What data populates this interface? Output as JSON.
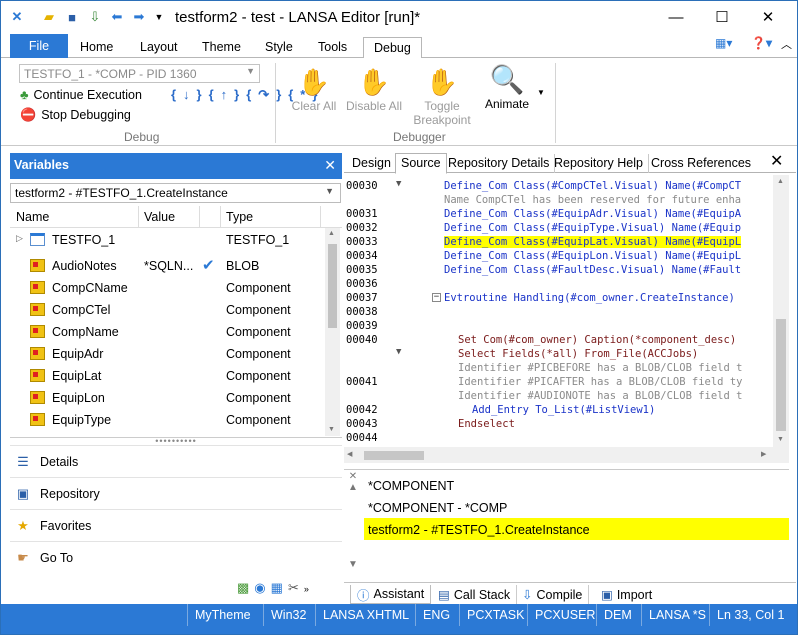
{
  "window": {
    "title": "testform2 - test - LANSA Editor [run]*"
  },
  "ribbon_tabs": [
    "File",
    "Home",
    "Layout",
    "Theme",
    "Style",
    "Tools",
    "Debug"
  ],
  "ribbon": {
    "process_select": "TESTFO_1 - *COMP - PID 1360",
    "continue_label": "Continue Execution",
    "stop_label": "Stop Debugging",
    "debug_group_label": "Debug",
    "clear_all_label": "Clear All",
    "disable_all_label": "Disable All",
    "toggle_label_1": "Toggle",
    "toggle_label_2": "Breakpoint",
    "animate_label": "Animate",
    "debugger_group_label": "Debugger"
  },
  "variables": {
    "header": "Variables",
    "selector": "testform2 - #TESTFO_1.CreateInstance",
    "columns": [
      "Name",
      "Value",
      "Type"
    ],
    "rows": [
      {
        "name": "TESTFO_1",
        "value": "",
        "type": "TESTFO_1",
        "icon": "form-icon",
        "checked": false
      },
      {
        "name": "AudioNotes",
        "value": "*SQLN...",
        "type": "BLOB",
        "icon": "blob-icon",
        "checked": true
      },
      {
        "name": "CompCName",
        "value": "",
        "type": "Component",
        "icon": "blob-icon",
        "checked": false
      },
      {
        "name": "CompCTel",
        "value": "",
        "type": "Component",
        "icon": "blob-icon",
        "checked": false
      },
      {
        "name": "CompName",
        "value": "",
        "type": "Component",
        "icon": "blob-icon",
        "checked": false
      },
      {
        "name": "EquipAdr",
        "value": "",
        "type": "Component",
        "icon": "blob-icon",
        "checked": false
      },
      {
        "name": "EquipLat",
        "value": "",
        "type": "Component",
        "icon": "blob-icon",
        "checked": false
      },
      {
        "name": "EquipLon",
        "value": "",
        "type": "Component",
        "icon": "blob-icon",
        "checked": false
      },
      {
        "name": "EquipType",
        "value": "",
        "type": "Component",
        "icon": "blob-icon",
        "checked": false
      }
    ]
  },
  "nav": {
    "details": "Details",
    "repository": "Repository",
    "favorites": "Favorites",
    "goto": "Go To"
  },
  "source_tabs": [
    "Design",
    "Source",
    "Repository Details",
    "Repository Help",
    "Cross References"
  ],
  "code_lines": [
    {
      "ln": "00030",
      "text": "Define_Com Class(#CompCTel.Visual) Name(#CompCT",
      "kind": "kw",
      "indent": 100,
      "fold": true
    },
    {
      "ln": "",
      "text": "Name CompCTel has been reserved for future enha",
      "kind": "cm",
      "indent": 100
    },
    {
      "ln": "00031",
      "text": "Define_Com Class(#EquipAdr.Visual) Name(#EquipA",
      "kind": "kw",
      "indent": 100
    },
    {
      "ln": "00032",
      "text": "Define_Com Class(#EquipType.Visual) Name(#Equip",
      "kind": "kw",
      "indent": 100
    },
    {
      "ln": "00033",
      "text": "Define_Com Class(#EquipLat.Visual) Name(#EquipL",
      "kind": "kw",
      "indent": 100,
      "hl": true
    },
    {
      "ln": "00034",
      "text": "Define_Com Class(#EquipLon.Visual) Name(#EquipL",
      "kind": "kw",
      "indent": 100
    },
    {
      "ln": "00035",
      "text": "Define_Com Class(#FaultDesc.Visual) Name(#Fault",
      "kind": "kw",
      "indent": 100
    },
    {
      "ln": "00036",
      "text": "",
      "kind": "kw",
      "indent": 100
    },
    {
      "ln": "00037",
      "text": "Evtroutine Handling(#com_owner.CreateInstance)",
      "kind": "kw",
      "indent": 100,
      "box": true
    },
    {
      "ln": "00038",
      "text": "",
      "kind": "kw",
      "indent": 100
    },
    {
      "ln": "00039",
      "text": "",
      "kind": "kw",
      "indent": 100
    },
    {
      "ln": "00040",
      "text": "Set Com(#com_owner) Caption(*component_desc)",
      "kind": "nm",
      "indent": 114
    },
    {
      "ln": "",
      "text": "Select Fields(*all) From_File(ACCJobs)",
      "kind": "nm",
      "indent": 114,
      "fold": true
    },
    {
      "ln": "",
      "text": "Identifier #PICBEFORE has a BLOB/CLOB field t",
      "kind": "cm",
      "indent": 114
    },
    {
      "ln": "00041",
      "text": "Identifier #PICAFTER has a BLOB/CLOB field ty",
      "kind": "cm",
      "indent": 114
    },
    {
      "ln": "",
      "text": "Identifier #AUDIONOTE has a BLOB/CLOB field t",
      "kind": "cm",
      "indent": 114
    },
    {
      "ln": "00042",
      "text": "Add_Entry To_List(#ListView1)",
      "kind": "kw",
      "indent": 128
    },
    {
      "ln": "00043",
      "text": "Endselect",
      "kind": "nm",
      "indent": 114
    },
    {
      "ln": "00044",
      "text": "",
      "kind": "kw",
      "indent": 100
    }
  ],
  "assistant": {
    "rows": [
      "*COMPONENT",
      "*COMPONENT - *COMP",
      "testform2 - #TESTFO_1.CreateInstance"
    ]
  },
  "bottom_tabs": [
    "Assistant",
    "Call Stack",
    "Compile",
    "Import"
  ],
  "status_bar": [
    "MyTheme",
    "Win32",
    "LANSA XHTML",
    "ENG",
    "PCXTASK",
    "PCXUSER",
    "DEM",
    "LANSA *S",
    "Ln 33, Col 1"
  ]
}
